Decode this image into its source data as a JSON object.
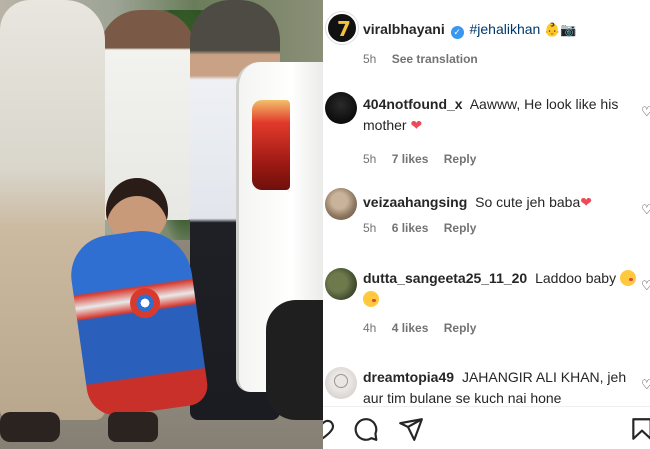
{
  "post": {
    "username": "viralbhayani",
    "verified": true,
    "hashtag": "#jehalikhan",
    "caption_emojis": "👶📷",
    "time": "5h",
    "see_translation": "See translation"
  },
  "comments": [
    {
      "username": "404notfound_x",
      "text": "Aawww, He look like his mother",
      "emoji": "❤",
      "time": "5h",
      "likes": "7 likes",
      "reply": "Reply"
    },
    {
      "username": "veizaahangsing",
      "text": "So cute jeh baba",
      "emoji": "❤",
      "time": "5h",
      "likes": "6 likes",
      "reply": "Reply"
    },
    {
      "username": "dutta_sangeeta25_11_20",
      "text": "Laddoo baby",
      "emoji": "😘😘",
      "time": "4h",
      "likes": "4 likes",
      "reply": "Reply"
    },
    {
      "username": "dreamtopia49",
      "text": "JAHANGIR ALI KHAN, jeh aur tim bulane se kuch nai hone",
      "time": "",
      "likes": "",
      "reply": ""
    }
  ],
  "actions": {
    "icons": [
      "heart-icon",
      "comment-icon",
      "share-icon",
      "bookmark-icon"
    ]
  },
  "colors": {
    "username": "#262626",
    "hashtag": "#00376b",
    "meta": "#737373",
    "verified": "#3897f0",
    "heart": "#ed4956"
  }
}
